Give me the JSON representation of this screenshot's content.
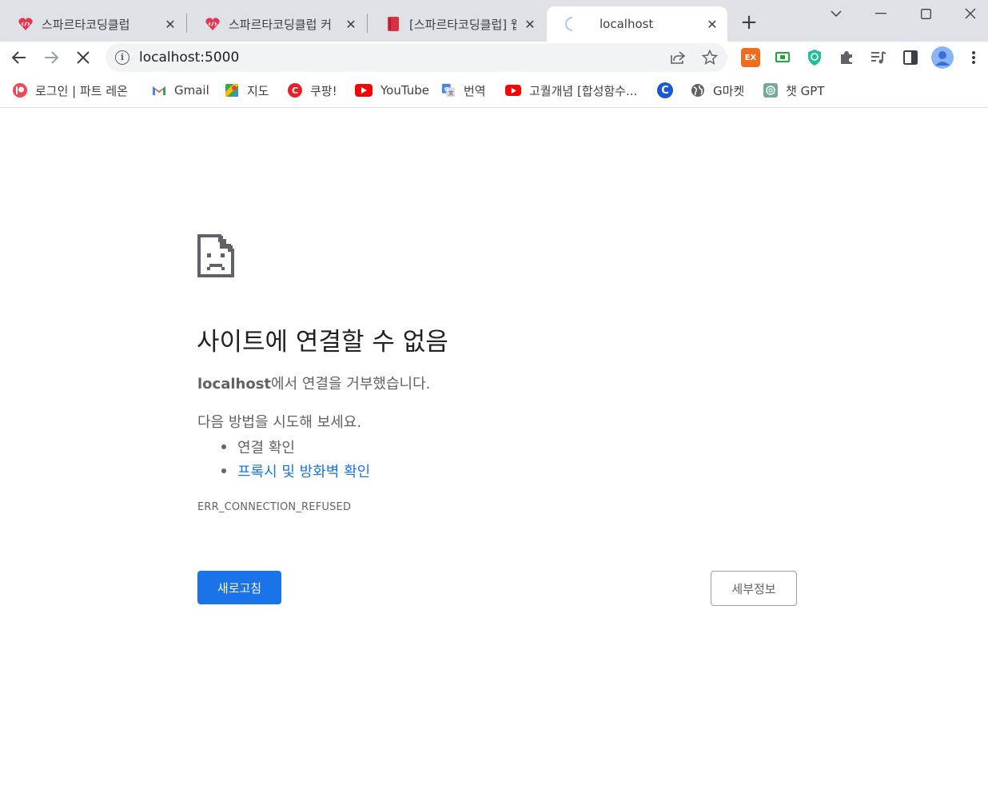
{
  "tabs": [
    {
      "title": "스파르타코딩클럽",
      "icon": "sparta-icon"
    },
    {
      "title": "스파르타코딩클럽 커",
      "icon": "sparta-icon"
    },
    {
      "title": "[스파르타코딩클럽] 웹",
      "icon": "book-icon"
    },
    {
      "title": "localhost",
      "icon": "loading-icon",
      "active": true
    }
  ],
  "address_bar": {
    "url": "localhost:5000"
  },
  "bookmarks": [
    {
      "label": "로그인 | 파트 레온",
      "icon": "patreon-icon"
    },
    {
      "label": "Gmail",
      "icon": "gmail-icon"
    },
    {
      "label": "지도",
      "icon": "maps-icon"
    },
    {
      "label": "쿠팡!",
      "icon": "coupang-icon"
    },
    {
      "label": "YouTube",
      "icon": "youtube-icon"
    },
    {
      "label": "번역",
      "icon": "translate-icon"
    },
    {
      "label": "고퀄개념 [합성함수...",
      "icon": "youtube-icon"
    },
    {
      "label": "",
      "icon": "c-icon"
    },
    {
      "label": "G마켓",
      "icon": "globe-icon"
    },
    {
      "label": "챗 GPT",
      "icon": "chatgpt-icon"
    }
  ],
  "error": {
    "heading": "사이트에 연결할 수 없음",
    "host": "localhost",
    "description_suffix": "에서 연결을 거부했습니다.",
    "suggest_title": "다음 방법을 시도해 보세요.",
    "suggestions": [
      "연결 확인",
      "프록시 및 방화벽 확인"
    ],
    "error_code": "ERR_CONNECTION_REFUSED",
    "reload_label": "새로고침",
    "details_label": "세부정보"
  },
  "colors": {
    "accent": "#1a73e8",
    "tabstrip": "#dee1e6",
    "text_secondary": "#5f6368"
  }
}
